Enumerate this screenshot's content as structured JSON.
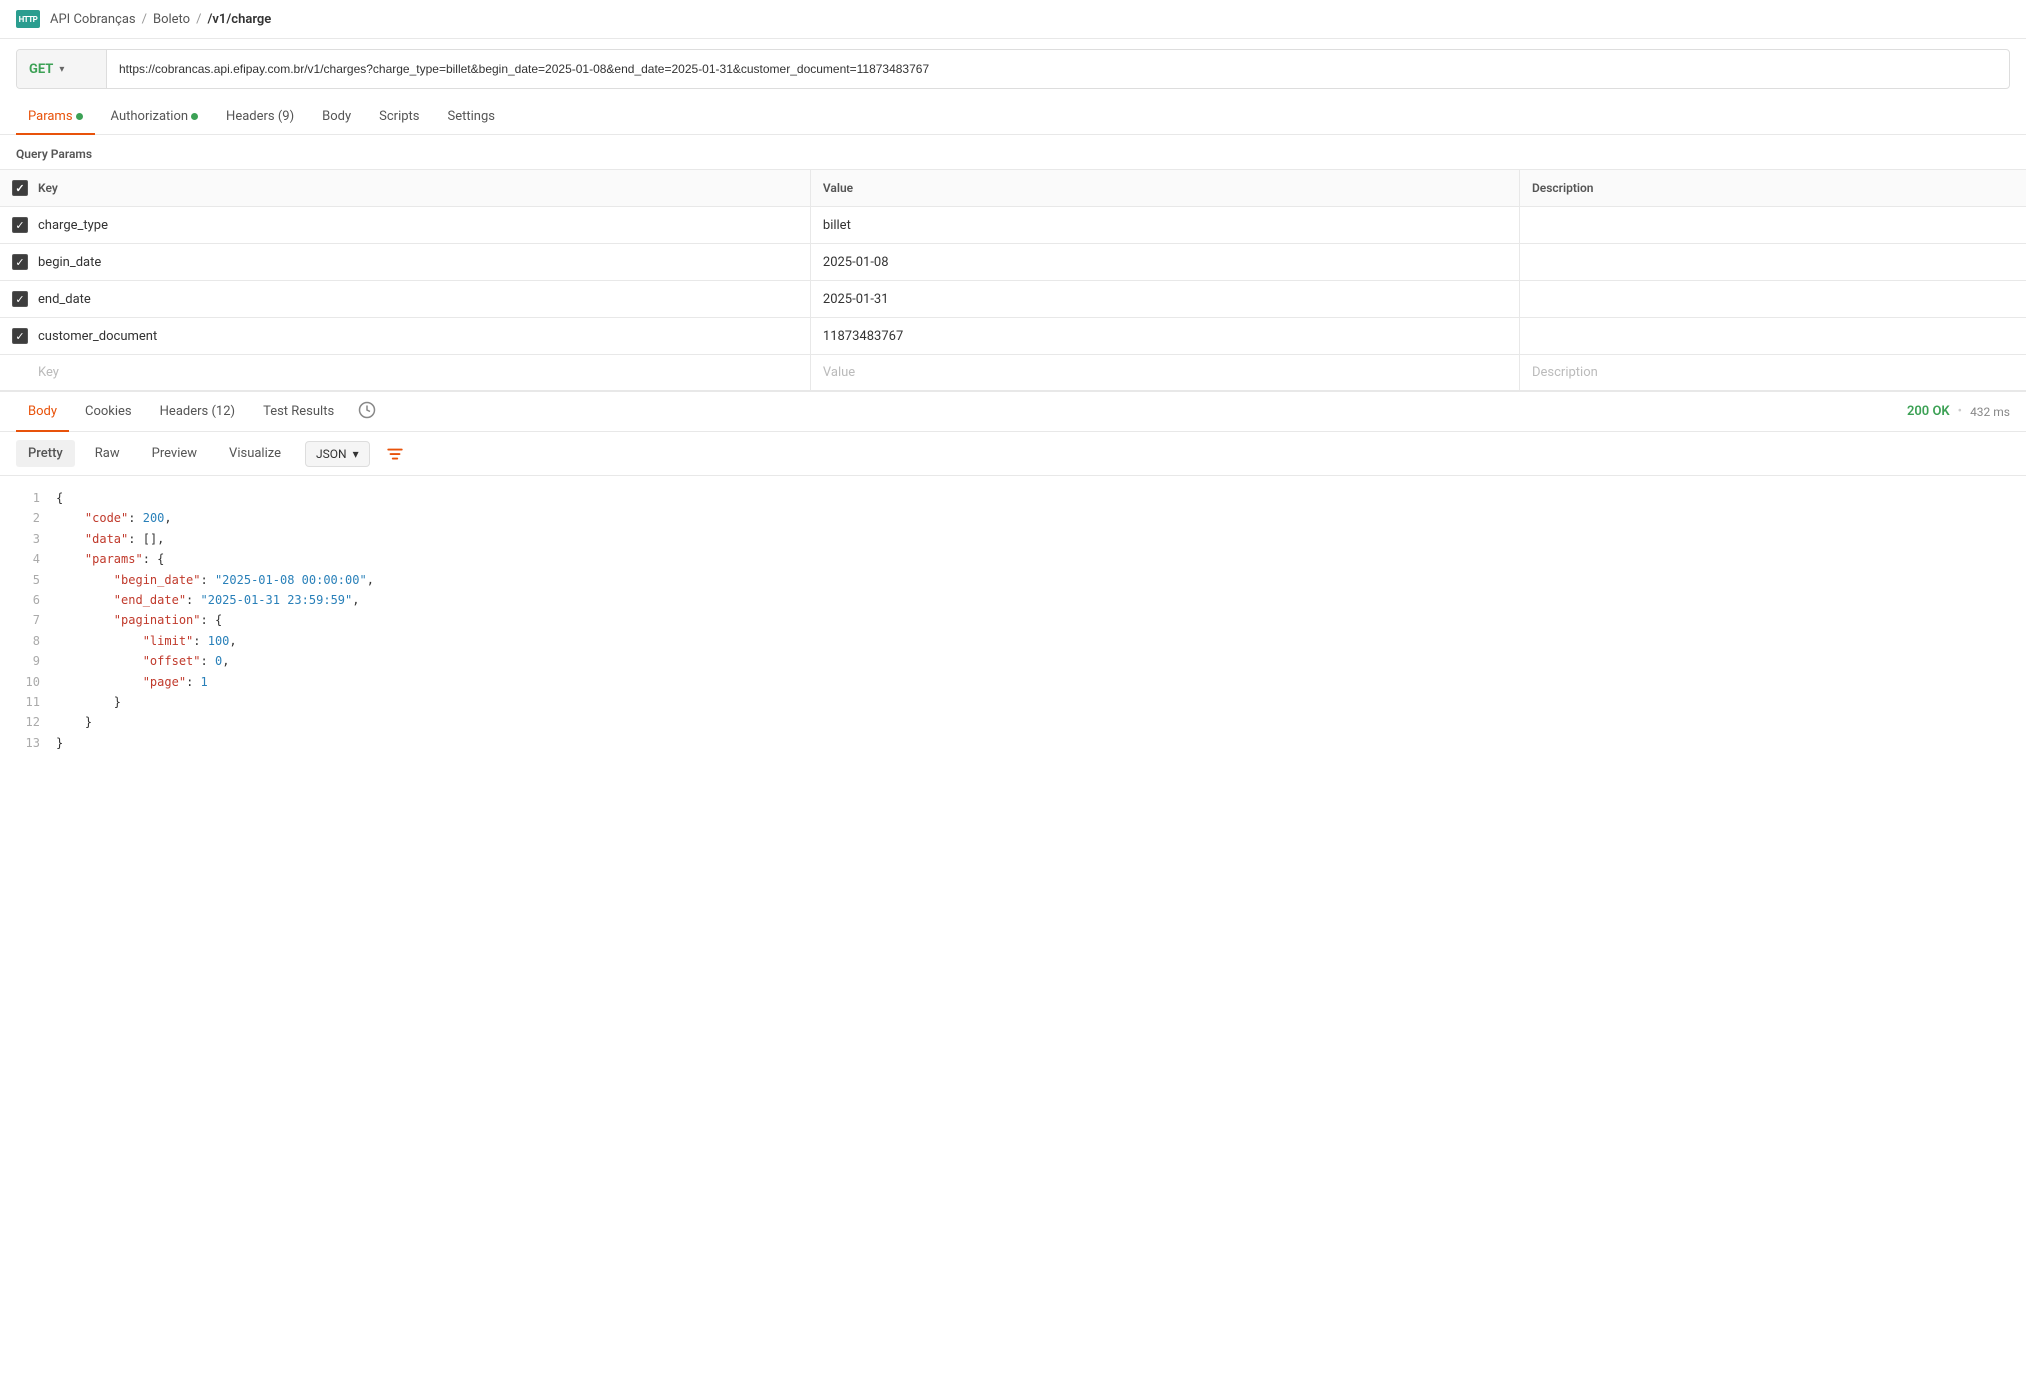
{
  "breadcrumb": {
    "icon_text": "HTTP",
    "items": [
      "API Cobranças",
      "Boleto",
      "/v1/charge"
    ]
  },
  "url_bar": {
    "method": "GET",
    "url": "https://cobrancas.api.efipay.com.br/v1/charges?charge_type=billet&begin_date=2025-01-08&end_date=2025-01-31&customer_document=11873483767"
  },
  "request_tabs": [
    {
      "label": "Params",
      "dot": true,
      "active": true
    },
    {
      "label": "Authorization",
      "dot": true,
      "active": false
    },
    {
      "label": "Headers (9)",
      "dot": false,
      "active": false
    },
    {
      "label": "Body",
      "dot": false,
      "active": false
    },
    {
      "label": "Scripts",
      "dot": false,
      "active": false
    },
    {
      "label": "Settings",
      "dot": false,
      "active": false
    }
  ],
  "query_params": {
    "section_label": "Query Params",
    "columns": [
      "Key",
      "Value",
      "Description"
    ],
    "rows": [
      {
        "checked": true,
        "key": "charge_type",
        "value": "billet",
        "description": ""
      },
      {
        "checked": true,
        "key": "begin_date",
        "value": "2025-01-08",
        "description": ""
      },
      {
        "checked": true,
        "key": "end_date",
        "value": "2025-01-31",
        "description": ""
      },
      {
        "checked": true,
        "key": "customer_document",
        "value": "11873483767",
        "description": ""
      }
    ],
    "empty_row": {
      "key": "Key",
      "value": "Value",
      "description": "Description"
    }
  },
  "response": {
    "tabs": [
      "Body",
      "Cookies",
      "Headers (12)",
      "Test Results"
    ],
    "active_tab": "Body",
    "status": "200 OK",
    "time": "432 ms",
    "format_tabs": [
      "Pretty",
      "Raw",
      "Preview",
      "Visualize"
    ],
    "active_format": "Pretty",
    "format_select": "JSON",
    "json_lines": [
      {
        "num": 1,
        "content": "{"
      },
      {
        "num": 2,
        "content": "    \"code\": 200,"
      },
      {
        "num": 3,
        "content": "    \"data\": [],"
      },
      {
        "num": 4,
        "content": "    \"params\": {"
      },
      {
        "num": 5,
        "content": "        \"begin_date\": \"2025-01-08 00:00:00\","
      },
      {
        "num": 6,
        "content": "        \"end_date\": \"2025-01-31 23:59:59\","
      },
      {
        "num": 7,
        "content": "        \"pagination\": {"
      },
      {
        "num": 8,
        "content": "            \"limit\": 100,"
      },
      {
        "num": 9,
        "content": "            \"offset\": 0,"
      },
      {
        "num": 10,
        "content": "            \"page\": 1"
      },
      {
        "num": 11,
        "content": "        }"
      },
      {
        "num": 12,
        "content": "    }"
      },
      {
        "num": 13,
        "content": "}"
      }
    ]
  }
}
